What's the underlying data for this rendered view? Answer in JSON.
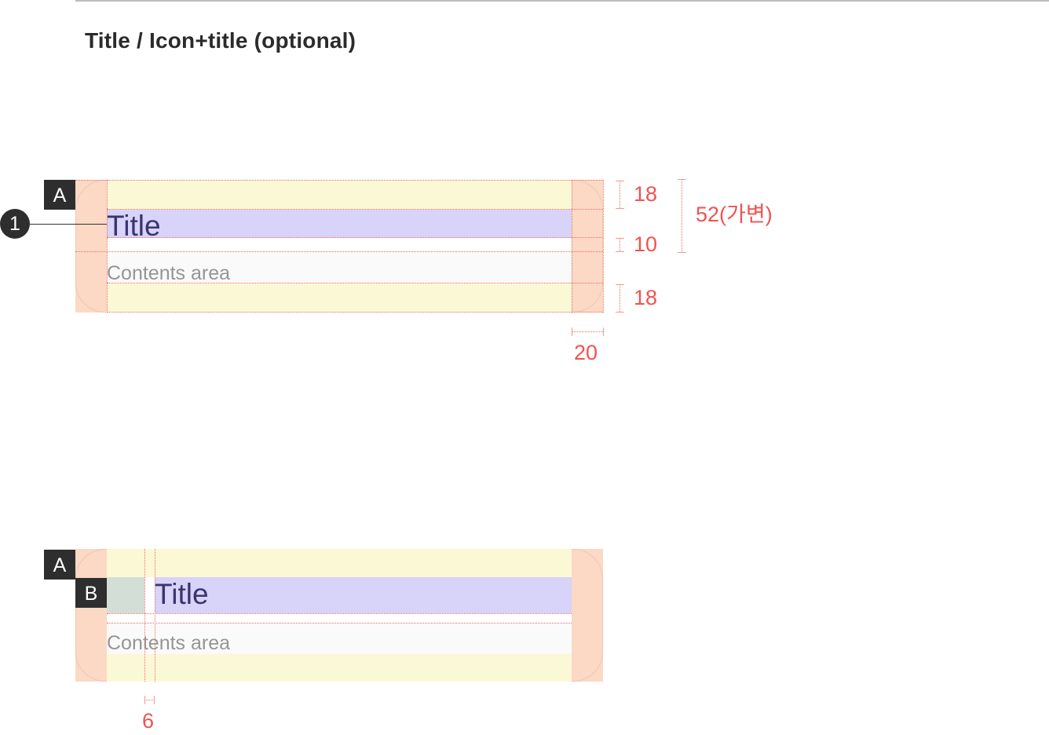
{
  "section_title": "Title / Icon+title (optional)",
  "diagram1": {
    "tag": "A",
    "callout": "1",
    "title": "Title",
    "contents": "Contents area",
    "dims": {
      "top": "18",
      "middle": "10",
      "bottom": "18",
      "total": "52(가변)",
      "side": "20"
    }
  },
  "diagram2": {
    "tag_a": "A",
    "tag_b": "B",
    "title": "Title",
    "contents": "Contents area",
    "dims": {
      "gap": "6"
    }
  },
  "colors": {
    "padding": "#fbd9c4",
    "spacing": "#fbf8d5",
    "title_area": "#d8d3f8",
    "icon_area": "#d3ded6",
    "content_area": "#fafafa",
    "measure": "#ef5350",
    "tag": "#2e2e2e"
  }
}
